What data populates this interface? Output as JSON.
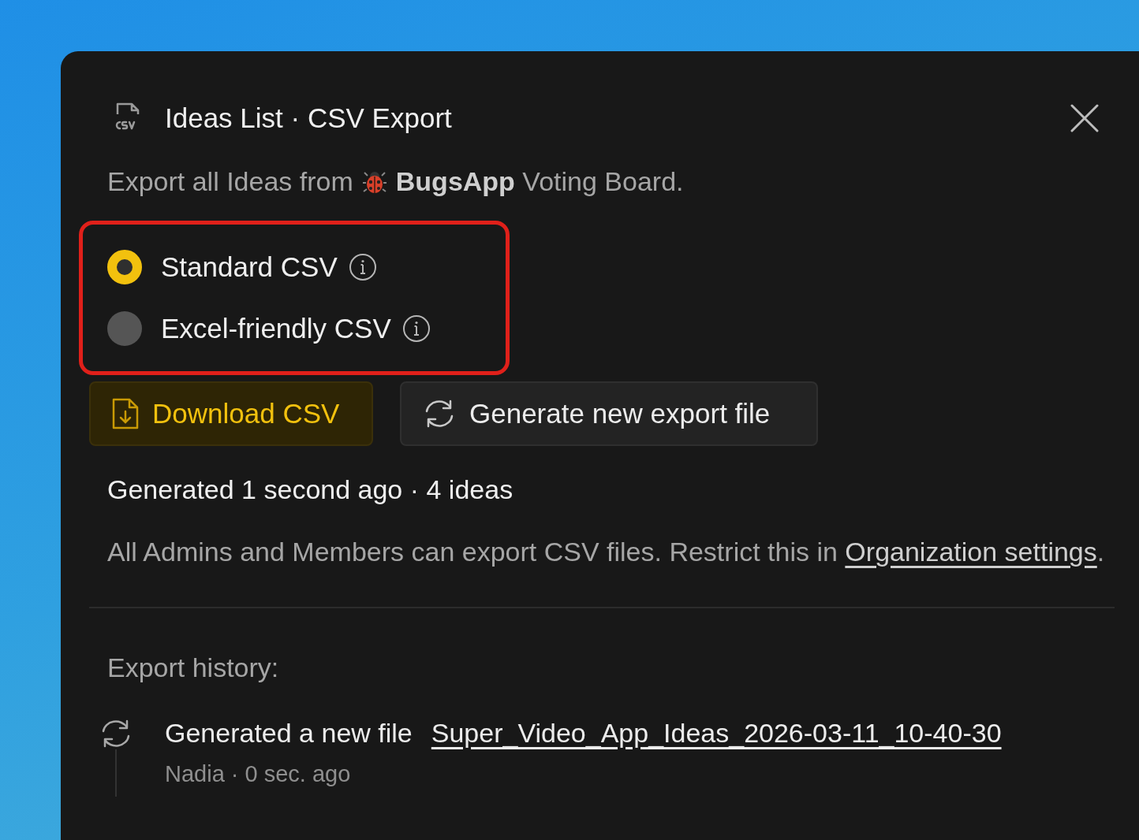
{
  "dialog": {
    "title": "Ideas List · CSV Export",
    "subtitle_prefix": "Export all Ideas from",
    "subtitle_rest": "**BugsApp** Voting Board."
  },
  "formats": [
    {
      "label": "Standard CSV",
      "selected": true
    },
    {
      "label": "Excel-friendly CSV",
      "selected": false
    }
  ],
  "buttons": [
    {
      "kind": "download",
      "label": "Download CSV"
    },
    {
      "kind": "regenerate",
      "label": "Generate new export file"
    }
  ],
  "status": "Generated 1 second ago · 4 ideas",
  "permissions_note": {
    "text": "All Admins and Members can export CSV files. Restrict this in",
    "link": "Organization settings",
    "end": "."
  },
  "history": {
    "heading": "Export history:",
    "entries": [
      {
        "action": "Generated a new file",
        "file": "Super_Video_App_Ideas_2026-03-11_10-40-30",
        "meta": "Nadia · 0 sec. ago"
      }
    ]
  }
}
